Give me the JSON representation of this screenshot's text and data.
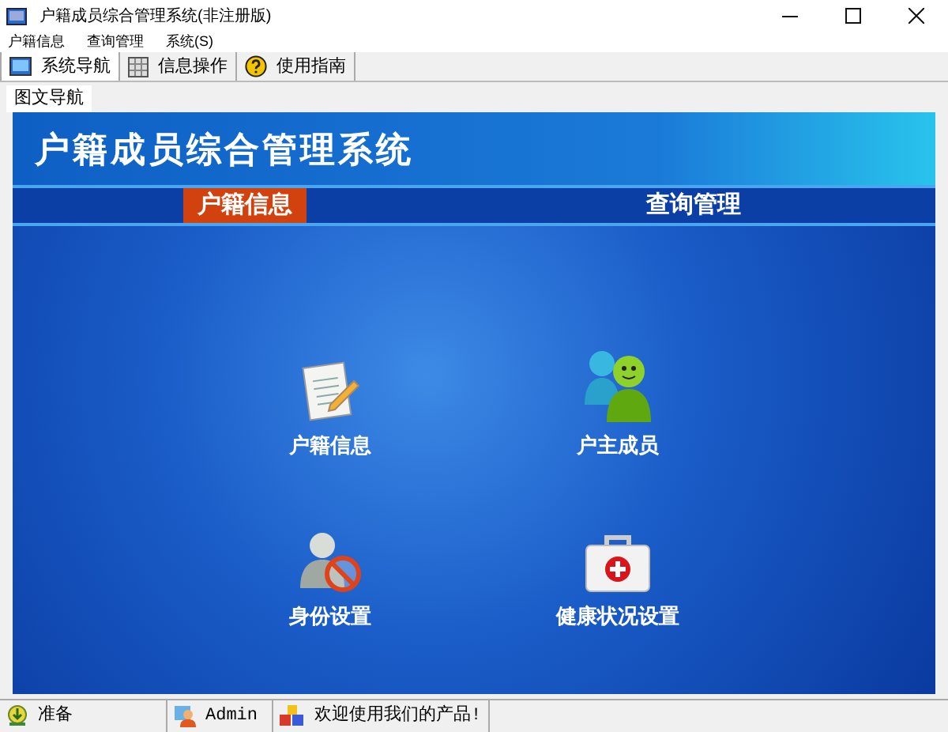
{
  "window": {
    "title": "户籍成员综合管理系统(非注册版)"
  },
  "menu": [
    "户籍信息",
    "查询管理",
    "系统(S)"
  ],
  "toolbar_tabs": [
    {
      "label": "系统导航",
      "selected": true,
      "kind": "nav"
    },
    {
      "label": "信息操作",
      "selected": false,
      "kind": "grid"
    },
    {
      "label": "使用指南",
      "selected": false,
      "kind": "help"
    }
  ],
  "page_tab": {
    "label": "图文导航",
    "selected": true
  },
  "banner": {
    "title": "户籍成员综合管理系统"
  },
  "nav_tabs": [
    {
      "label": "户籍信息",
      "selected": true
    },
    {
      "label": "查询管理",
      "selected": false
    }
  ],
  "tiles": [
    {
      "label": "户籍信息",
      "kind": "notes"
    },
    {
      "label": "户主成员",
      "kind": "people"
    },
    {
      "label": "身份设置",
      "kind": "blocked-user"
    },
    {
      "label": "健康状况设置",
      "kind": "medkit"
    }
  ],
  "status_bar": [
    {
      "text": "准备",
      "kind": "ready"
    },
    {
      "text": "Admin",
      "kind": "user"
    },
    {
      "text": "欢迎使用我们的产品!",
      "kind": "product"
    }
  ]
}
